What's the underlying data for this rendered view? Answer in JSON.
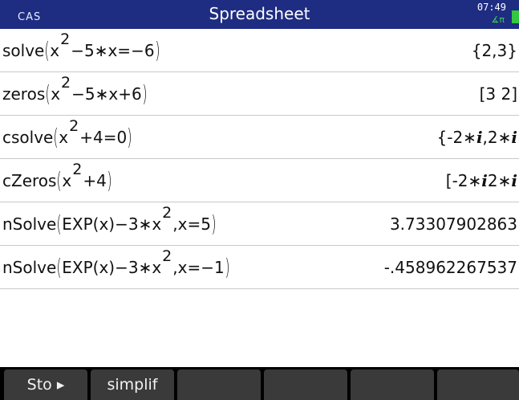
{
  "status_bar": {
    "mode": "CAS",
    "title": "Spreadsheet",
    "time": "07:49",
    "angle_mode": "∡π"
  },
  "history": [
    {
      "fn": "solve",
      "a": "x",
      "exp": "2",
      "b": "−5∗x=−6",
      "result": "{2,3}"
    },
    {
      "fn": "zeros",
      "a": "x",
      "exp": "2",
      "b": "−5∗x+6",
      "result": "[3 2]"
    },
    {
      "fn": "csolve",
      "a": "x",
      "exp": "2",
      "b": "+4=0",
      "result_a": "{-2∗",
      "result_i1": "i",
      "result_b": ",2∗",
      "result_i2": "i"
    },
    {
      "fn": "cZeros",
      "a": "x",
      "exp": "2",
      "b": "+4",
      "result_a": "[-2∗",
      "result_i1": "i",
      "result_b": " 2∗",
      "result_i2": "i"
    },
    {
      "fn": "nSolve",
      "a": "EXP(x)−3∗x",
      "exp": "2",
      "b": ",x=5",
      "result": "3.73307902863"
    },
    {
      "fn": "nSolve",
      "a": "EXP(x)−3∗x",
      "exp": "2",
      "b": ",x=−1",
      "result": "-.458962267537"
    }
  ],
  "menu": {
    "sto_label": "Sto ▸",
    "simplify_label": "simplif"
  },
  "colors": {
    "title_bar": "#1e2c82",
    "softkey": "#3a3a3a",
    "battery": "#34c73f"
  }
}
